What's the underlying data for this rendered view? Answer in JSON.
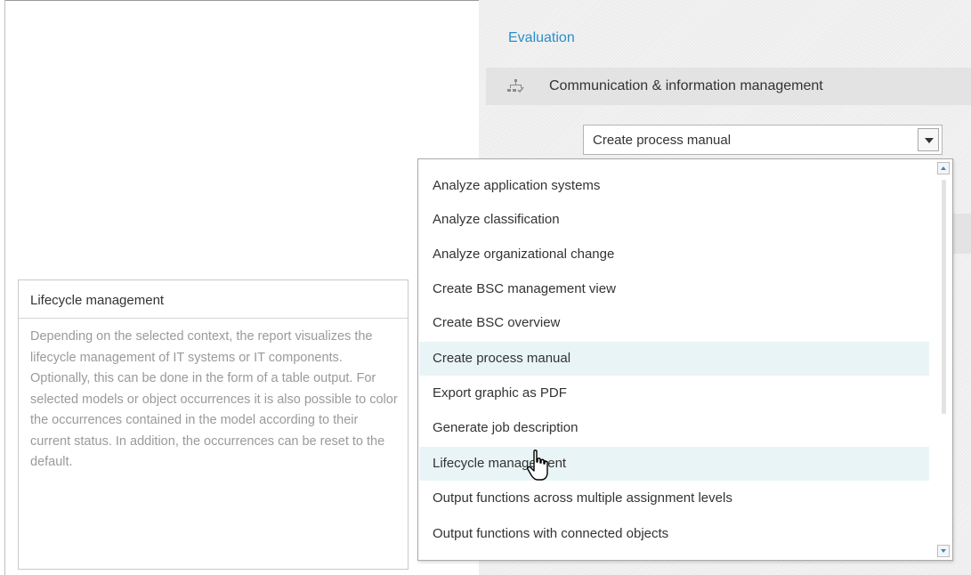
{
  "header": {
    "evaluation_label": "Evaluation",
    "category_label": "Communication & information management",
    "category_icon": "process-icon"
  },
  "select": {
    "value": "Create process manual",
    "arrow_icon": "chevron-down-icon"
  },
  "dropdown": {
    "options": [
      "Analyze application systems",
      "Analyze classification",
      "Analyze organizational change",
      "Create BSC management view",
      "Create BSC overview",
      "Create process manual",
      "Export graphic as PDF",
      "Generate job description",
      "Lifecycle management",
      "Output functions across multiple assignment levels",
      "Output functions with connected objects"
    ],
    "selected": "Create process manual",
    "hovered": "Lifecycle management"
  },
  "tooltip": {
    "title": "Lifecycle management",
    "description": [
      "Depending on the selected context, the report visualizes the lifecycle management of IT systems or IT components.",
      "Optionally, this can be done in the form of a table output. For selected models or object occurrences it is also possible to color the occurrences contained in the model according to their current status. In addition, the occurrences can be reset to the default."
    ]
  },
  "colors": {
    "accent": "#2a8ec8",
    "highlight": "#e9f4f6",
    "panel": "#f2f2f2"
  }
}
